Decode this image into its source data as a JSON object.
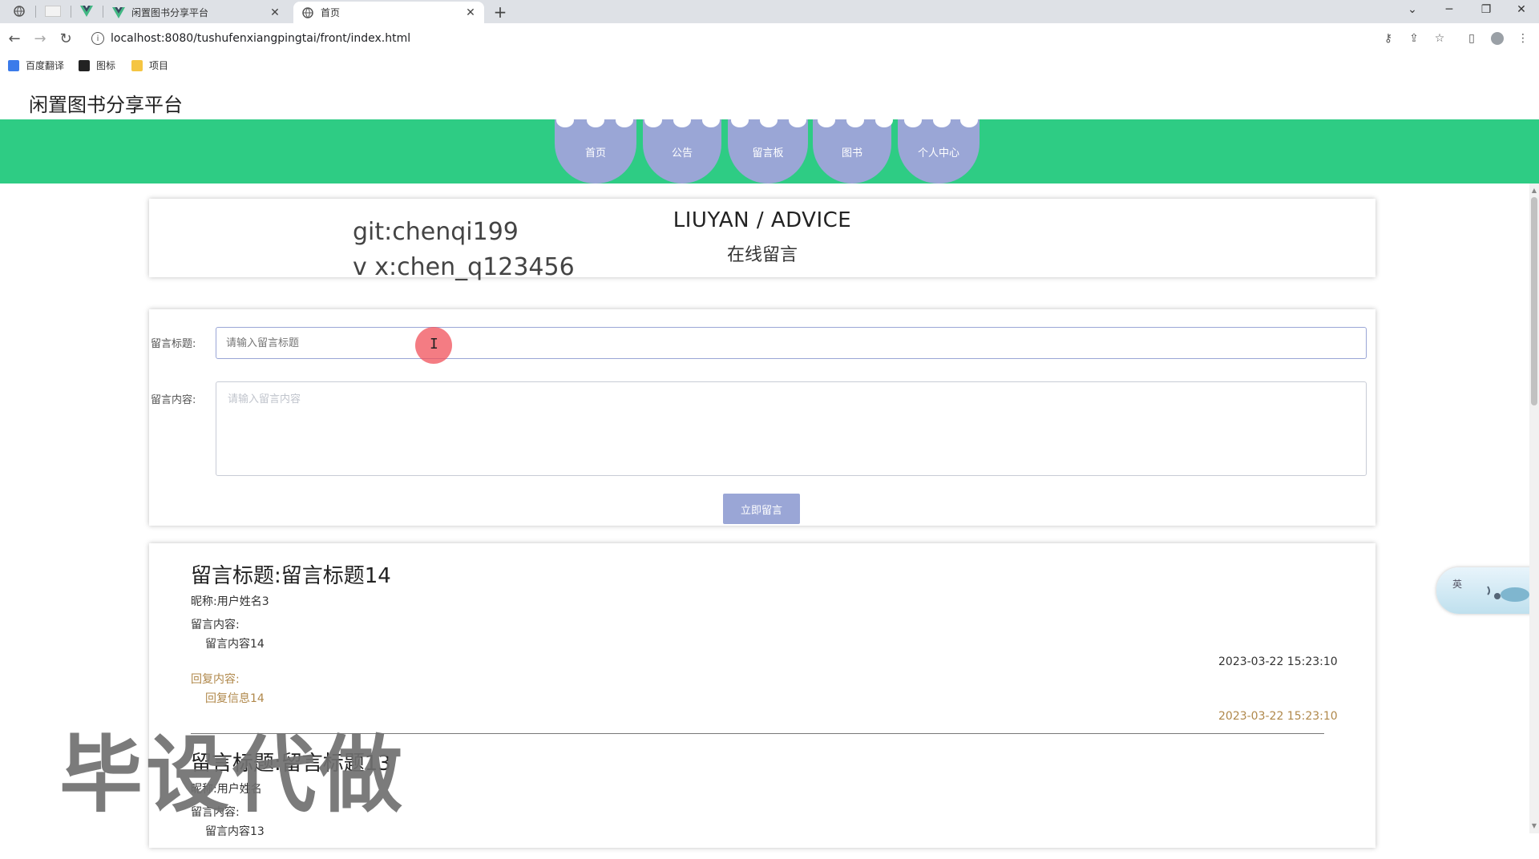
{
  "browser": {
    "tabs": [
      {
        "title": "闲置图书分享平台",
        "active": false
      },
      {
        "title": "首页",
        "active": true
      }
    ],
    "url": "localhost:8080/tushufenxiangpingtai/front/index.html",
    "bookmarks": [
      "百度翻译",
      "图标",
      "项目"
    ]
  },
  "site": {
    "title": "闲置图书分享平台",
    "nav": [
      "首页",
      "公告",
      "留言板",
      "图书",
      "个人中心"
    ]
  },
  "advice": {
    "title": "LIUYAN / ADVICE",
    "subtitle": "在线留言",
    "overlay_lines": [
      "git:chenqi199",
      "v x:chen_q123456"
    ]
  },
  "form": {
    "title_label": "留言标题:",
    "title_placeholder": "请输入留言标题",
    "content_label": "留言内容:",
    "content_placeholder": "请输入留言内容",
    "submit_label": "立即留言"
  },
  "messages": [
    {
      "title": "留言标题:留言标题14",
      "nickname": "昵称:用户姓名3",
      "content_label": "留言内容:",
      "content": "留言内容14",
      "time": "2023-03-22 15:23:10",
      "reply_label": "回复内容:",
      "reply": "回复信息14",
      "reply_time": "2023-03-22 15:23:10"
    },
    {
      "title": "留言标题:留言标题13",
      "nickname": "昵称:用户姓名",
      "content_label": "留言内容:",
      "content": "留言内容13"
    }
  ],
  "watermark": "毕设代做",
  "widget": {
    "label": "英"
  },
  "colors": {
    "nav_band": "#2ecc84",
    "nav_item": "#9aa6d6",
    "reply_text": "#b0884b"
  }
}
